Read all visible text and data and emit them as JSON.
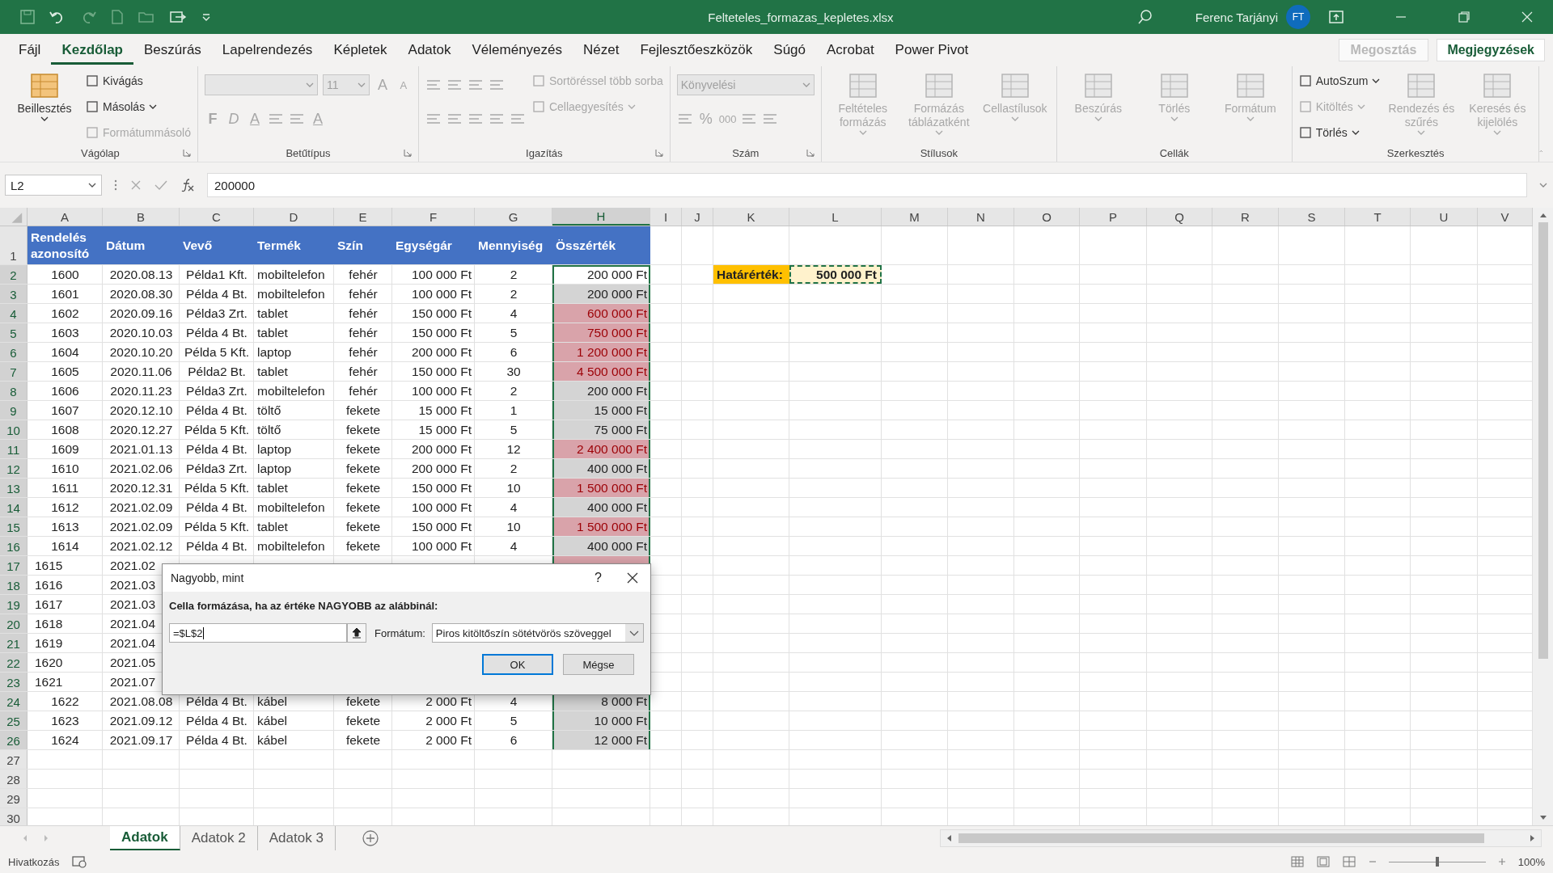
{
  "title_bar": {
    "filename": "Felteteles_formazas_kepletes.xlsx",
    "user": "Ferenc Tarjányi",
    "initials": "FT"
  },
  "menu_tabs": [
    {
      "label": "Fájl",
      "selected": false
    },
    {
      "label": "Kezdőlap",
      "selected": true
    },
    {
      "label": "Beszúrás",
      "selected": false
    },
    {
      "label": "Lapelrendezés",
      "selected": false
    },
    {
      "label": "Képletek",
      "selected": false
    },
    {
      "label": "Adatok",
      "selected": false
    },
    {
      "label": "Véleményezés",
      "selected": false
    },
    {
      "label": "Nézet",
      "selected": false
    },
    {
      "label": "Fejlesztőeszközök",
      "selected": false
    },
    {
      "label": "Súgó",
      "selected": false
    },
    {
      "label": "Acrobat",
      "selected": false
    },
    {
      "label": "Power Pivot",
      "selected": false
    }
  ],
  "share_button": {
    "label": "Megosztás",
    "disabled": true
  },
  "comments_button": {
    "label": "Megjegyzések",
    "disabled": false
  },
  "ribbon_groups": [
    {
      "label": "Vágólap",
      "launcher": true,
      "columns": [
        [
          {
            "kind": "large",
            "label": "Beillesztés",
            "disabled": false,
            "dropdown": true
          }
        ],
        [
          {
            "kind": "small",
            "label": "Kivágás",
            "disabled": false,
            "dropdown": false
          },
          {
            "kind": "small",
            "label": "Másolás",
            "disabled": false,
            "dropdown": true
          },
          {
            "kind": "small",
            "label": "Formátummásoló",
            "disabled": true,
            "dropdown": false
          }
        ]
      ]
    },
    {
      "label": "Betűtípus",
      "launcher": true,
      "columns": [
        [
          {
            "kind": "toolrow",
            "tools": [
              {
                "kind": "field",
                "disabled": true
              },
              {
                "kind": "narrow_field",
                "value": "11",
                "disabled": true
              },
              {
                "kind": "letter",
                "text": "A",
                "disabled": true
              },
              {
                "kind": "small_letter",
                "text": "A",
                "disabled": true
              }
            ]
          },
          {
            "kind": "toolrow",
            "tools": [
              {
                "kind": "bold_letter",
                "text": "F",
                "disabled": true
              },
              {
                "kind": "italic_letter",
                "text": "D",
                "disabled": true
              },
              {
                "kind": "underlined_letter",
                "text": "A",
                "disabled": true
              },
              {
                "kind": "icon",
                "disabled": true
              },
              {
                "kind": "icon",
                "disabled": true
              },
              {
                "kind": "underlined_letter",
                "text": "A",
                "disabled": true
              }
            ]
          }
        ]
      ]
    },
    {
      "label": "Igazítás",
      "launcher": true,
      "columns": [
        [
          {
            "kind": "toolrow",
            "tools": [
              {
                "kind": "icon",
                "disabled": true
              },
              {
                "kind": "icon",
                "disabled": true
              },
              {
                "kind": "icon",
                "disabled": true
              },
              {
                "kind": "icon",
                "disabled": true
              }
            ]
          },
          {
            "kind": "toolrow",
            "tools": [
              {
                "kind": "icon",
                "disabled": true
              },
              {
                "kind": "icon",
                "disabled": true
              },
              {
                "kind": "icon",
                "disabled": true
              },
              {
                "kind": "icon",
                "disabled": true
              },
              {
                "kind": "icon",
                "disabled": true
              }
            ]
          }
        ],
        [
          {
            "kind": "small",
            "label": "Sortöréssel több sorba",
            "disabled": true,
            "dropdown": false
          },
          {
            "kind": "small",
            "label": "Cellaegyesítés",
            "disabled": true,
            "dropdown": true
          }
        ]
      ]
    },
    {
      "label": "Szám",
      "launcher": true,
      "columns": [
        [
          {
            "kind": "toolrow",
            "tools": [
              {
                "kind": "wide_field",
                "value": "Könyvelési",
                "disabled": true
              }
            ]
          },
          {
            "kind": "toolrow",
            "tools": [
              {
                "kind": "icon",
                "disabled": true
              },
              {
                "kind": "letter",
                "text": "%",
                "disabled": true
              },
              {
                "kind": "small_letter",
                "text": "000",
                "disabled": true
              },
              {
                "kind": "icon",
                "disabled": true
              },
              {
                "kind": "icon",
                "disabled": true
              }
            ]
          }
        ]
      ]
    },
    {
      "label": "Stílusok",
      "launcher": false,
      "columns": [
        [
          {
            "kind": "large",
            "label": "Feltételes formázás",
            "disabled": true,
            "dropdown": true
          }
        ],
        [
          {
            "kind": "large",
            "label": "Formázás táblázatként",
            "disabled": true,
            "dropdown": true
          }
        ],
        [
          {
            "kind": "large",
            "label": "Cellastílusok",
            "disabled": true,
            "dropdown": true
          }
        ]
      ]
    },
    {
      "label": "Cellák",
      "launcher": false,
      "columns": [
        [
          {
            "kind": "large",
            "label": "Beszúrás",
            "disabled": true,
            "dropdown": true
          }
        ],
        [
          {
            "kind": "large",
            "label": "Törlés",
            "disabled": true,
            "dropdown": true
          }
        ],
        [
          {
            "kind": "large",
            "label": "Formátum",
            "disabled": true,
            "dropdown": true
          }
        ]
      ]
    },
    {
      "label": "Szerkesztés",
      "launcher": false,
      "columns": [
        [
          {
            "kind": "small",
            "label": "AutoSzum",
            "disabled": false,
            "dropdown": true
          },
          {
            "kind": "small",
            "label": "Kitöltés",
            "disabled": true,
            "dropdown": true
          },
          {
            "kind": "small",
            "label": "Törlés",
            "disabled": false,
            "dropdown": true
          }
        ],
        [
          {
            "kind": "large",
            "label": "Rendezés és szűrés",
            "disabled": true,
            "dropdown": true
          }
        ],
        [
          {
            "kind": "large",
            "label": "Keresés és kijelölés",
            "disabled": true,
            "dropdown": true
          }
        ]
      ]
    }
  ],
  "formula_bar": {
    "name_box": "L2",
    "formula": "200000"
  },
  "sheet": {
    "columns": [
      {
        "label": "A",
        "selected": false
      },
      {
        "label": "B",
        "selected": false
      },
      {
        "label": "C",
        "selected": false
      },
      {
        "label": "D",
        "selected": false
      },
      {
        "label": "E",
        "selected": false
      },
      {
        "label": "F",
        "selected": false
      },
      {
        "label": "G",
        "selected": false
      },
      {
        "label": "H",
        "selected": true
      },
      {
        "label": "I",
        "selected": false
      },
      {
        "label": "J",
        "selected": false
      },
      {
        "label": "K",
        "selected": false
      },
      {
        "label": "L",
        "selected": false
      },
      {
        "label": "M",
        "selected": false
      },
      {
        "label": "N",
        "selected": false
      },
      {
        "label": "O",
        "selected": false
      },
      {
        "label": "P",
        "selected": false
      },
      {
        "label": "Q",
        "selected": false
      },
      {
        "label": "R",
        "selected": false
      },
      {
        "label": "S",
        "selected": false
      },
      {
        "label": "T",
        "selected": false
      },
      {
        "label": "U",
        "selected": false
      },
      {
        "label": "V",
        "selected": false
      }
    ],
    "row_headers": [
      {
        "label": "1",
        "selected": false
      },
      {
        "label": "2",
        "selected": true
      },
      {
        "label": "3",
        "selected": true
      },
      {
        "label": "4",
        "selected": true
      },
      {
        "label": "5",
        "selected": true
      },
      {
        "label": "6",
        "selected": true
      },
      {
        "label": "7",
        "selected": true
      },
      {
        "label": "8",
        "selected": true
      },
      {
        "label": "9",
        "selected": true
      },
      {
        "label": "10",
        "selected": true
      },
      {
        "label": "11",
        "selected": true
      },
      {
        "label": "12",
        "selected": true
      },
      {
        "label": "13",
        "selected": true
      },
      {
        "label": "14",
        "selected": true
      },
      {
        "label": "15",
        "selected": true
      },
      {
        "label": "16",
        "selected": true
      },
      {
        "label": "17",
        "selected": true
      },
      {
        "label": "18",
        "selected": true
      },
      {
        "label": "19",
        "selected": true
      },
      {
        "label": "20",
        "selected": true
      },
      {
        "label": "21",
        "selected": true
      },
      {
        "label": "22",
        "selected": true
      },
      {
        "label": "23",
        "selected": true
      },
      {
        "label": "24",
        "selected": true
      },
      {
        "label": "25",
        "selected": true
      },
      {
        "label": "26",
        "selected": true
      },
      {
        "label": "27",
        "selected": false
      },
      {
        "label": "28",
        "selected": false
      },
      {
        "label": "29",
        "selected": false
      },
      {
        "label": "30",
        "selected": false
      }
    ],
    "header": [
      "Rendelés azonosító",
      "Dátum",
      "Vevő",
      "Termék",
      "Szín",
      "Egységár",
      "Mennyiség",
      "Összérték"
    ],
    "rows": [
      {
        "cells": [
          "1600",
          "2020.08.13",
          "Példa1 Kft.",
          "mobiltelefon",
          "fehér",
          "100 000 Ft",
          "2",
          "200 000 Ft"
        ],
        "selected": false,
        "flagged": false
      },
      {
        "cells": [
          "1601",
          "2020.08.30",
          "Példa 4 Bt.",
          "mobiltelefon",
          "fehér",
          "100 000 Ft",
          "2",
          "200 000 Ft"
        ],
        "selected": true,
        "flagged": false
      },
      {
        "cells": [
          "1602",
          "2020.09.16",
          "Példa3 Zrt.",
          "tablet",
          "fehér",
          "150 000 Ft",
          "4",
          "600 000 Ft"
        ],
        "selected": true,
        "flagged": true
      },
      {
        "cells": [
          "1603",
          "2020.10.03",
          "Példa 4 Bt.",
          "tablet",
          "fehér",
          "150 000 Ft",
          "5",
          "750 000 Ft"
        ],
        "selected": true,
        "flagged": true
      },
      {
        "cells": [
          "1604",
          "2020.10.20",
          "Példa 5 Kft.",
          "laptop",
          "fehér",
          "200 000 Ft",
          "6",
          "1 200 000 Ft"
        ],
        "selected": true,
        "flagged": true
      },
      {
        "cells": [
          "1605",
          "2020.11.06",
          "Példa2 Bt.",
          "tablet",
          "fehér",
          "150 000 Ft",
          "30",
          "4 500 000 Ft"
        ],
        "selected": true,
        "flagged": true
      },
      {
        "cells": [
          "1606",
          "2020.11.23",
          "Példa3 Zrt.",
          "mobiltelefon",
          "fehér",
          "100 000 Ft",
          "2",
          "200 000 Ft"
        ],
        "selected": true,
        "flagged": false
      },
      {
        "cells": [
          "1607",
          "2020.12.10",
          "Példa 4 Bt.",
          "töltő",
          "fekete",
          "15 000 Ft",
          "1",
          "15 000 Ft"
        ],
        "selected": true,
        "flagged": false
      },
      {
        "cells": [
          "1608",
          "2020.12.27",
          "Példa 5 Kft.",
          "töltő",
          "fekete",
          "15 000 Ft",
          "5",
          "75 000 Ft"
        ],
        "selected": true,
        "flagged": false
      },
      {
        "cells": [
          "1609",
          "2021.01.13",
          "Példa 4 Bt.",
          "laptop",
          "fekete",
          "200 000 Ft",
          "12",
          "2 400 000 Ft"
        ],
        "selected": true,
        "flagged": true
      },
      {
        "cells": [
          "1610",
          "2021.02.06",
          "Példa3 Zrt.",
          "laptop",
          "fekete",
          "200 000 Ft",
          "2",
          "400 000 Ft"
        ],
        "selected": true,
        "flagged": false
      },
      {
        "cells": [
          "1611",
          "2020.12.31",
          "Példa 5 Kft.",
          "tablet",
          "fekete",
          "150 000 Ft",
          "10",
          "1 500 000 Ft"
        ],
        "selected": true,
        "flagged": true
      },
      {
        "cells": [
          "1612",
          "2021.02.09",
          "Példa 4 Bt.",
          "mobiltelefon",
          "fekete",
          "100 000 Ft",
          "4",
          "400 000 Ft"
        ],
        "selected": true,
        "flagged": false
      },
      {
        "cells": [
          "1613",
          "2021.02.09",
          "Példa 5 Kft.",
          "tablet",
          "fekete",
          "150 000 Ft",
          "10",
          "1 500 000 Ft"
        ],
        "selected": true,
        "flagged": true
      },
      {
        "cells": [
          "1614",
          "2021.02.12",
          "Példa 4 Bt.",
          "mobiltelefon",
          "fekete",
          "100 000 Ft",
          "4",
          "400 000 Ft"
        ],
        "selected": true,
        "flagged": false
      },
      {
        "cells": [
          "1615",
          "2021.02"
        ],
        "selected": true,
        "flagged": true
      },
      {
        "cells": [
          "1616",
          "2021.03"
        ]
      },
      {
        "cells": [
          "1617",
          "2021.03"
        ]
      },
      {
        "cells": [
          "1618",
          "2021.04"
        ]
      },
      {
        "cells": [
          "1619",
          "2021.04"
        ]
      },
      {
        "cells": [
          "1620",
          "2021.05"
        ]
      },
      {
        "cells": [
          "1621",
          "2021.07"
        ]
      },
      {
        "cells": [
          "1622",
          "2021.08.08",
          "Példa 4 Bt.",
          "kábel",
          "fekete",
          "2 000 Ft",
          "4",
          "8 000 Ft"
        ],
        "selected": true,
        "flagged": false
      },
      {
        "cells": [
          "1623",
          "2021.09.12",
          "Példa 4 Bt.",
          "kábel",
          "fekete",
          "2 000 Ft",
          "5",
          "10 000 Ft"
        ],
        "selected": true,
        "flagged": false
      },
      {
        "cells": [
          "1624",
          "2021.09.17",
          "Példa 4 Bt.",
          "kábel",
          "fekete",
          "2 000 Ft",
          "6",
          "12 000 Ft"
        ],
        "selected": true,
        "flagged": false
      }
    ],
    "threshold": {
      "label": "Határérték:",
      "value": "500 000 Ft",
      "marquee": true
    }
  },
  "dialog": {
    "title": "Nagyobb, mint",
    "help": "?",
    "prompt": "Cella formázása, ha az értéke NAGYOBB az alábbinál:",
    "value": "=$L$2",
    "format_label": "Formátum:",
    "format_value": "Piros kitöltőszín sötétvörös szöveggel",
    "ok": "OK",
    "cancel": "Mégse"
  },
  "sheet_tabs": [
    {
      "label": "Adatok",
      "selected": true
    },
    {
      "label": "Adatok 2",
      "selected": false
    },
    {
      "label": "Adatok 3",
      "selected": false
    }
  ],
  "status_bar": {
    "mode": "Hivatkozás",
    "zoom": "100%",
    "zoom_slider": {
      "level": 0.5
    }
  }
}
